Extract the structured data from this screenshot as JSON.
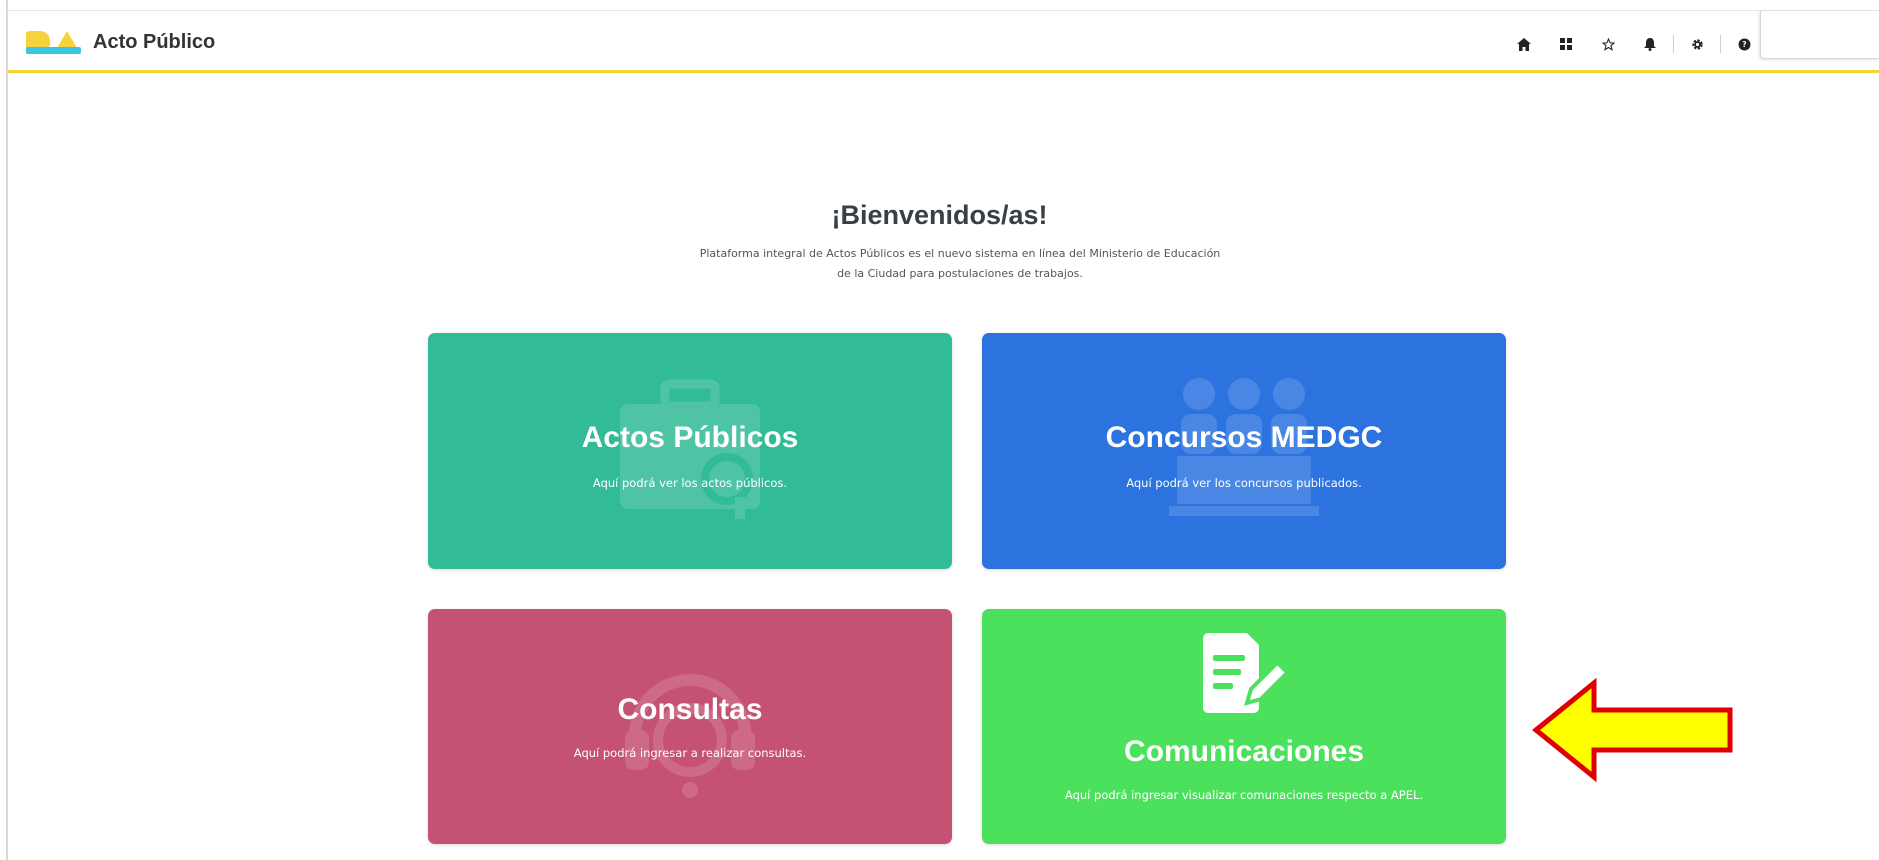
{
  "header": {
    "app_title": "Acto Público",
    "accent_color": "#f4d33a",
    "toolbar_icons": [
      "home-icon",
      "apps-grid-icon",
      "star-icon",
      "bell-icon",
      "gear-icon",
      "help-icon"
    ]
  },
  "welcome": {
    "title": "¡Bienvenidos/as!",
    "line1": "Plataforma integral de Actos Públicos es el nuevo sistema en línea del Ministerio de Educación",
    "line2": "de la Ciudad para postulaciones de trabajos."
  },
  "cards": [
    {
      "title": "Actos Públicos",
      "description": "Aquí podrá ver los actos públicos.",
      "color": "#31bb96",
      "icon": "briefcase-search-icon"
    },
    {
      "title": "Concursos MEDGC",
      "description": "Aquí podrá ver los concursos publicados.",
      "color": "#2c73e0",
      "icon": "panel-people-icon"
    },
    {
      "title": "Consultas",
      "description": "Aquí podrá ingresar a realizar consultas.",
      "color": "#c55173",
      "icon": "headset-help-icon"
    },
    {
      "title": "Comunicaciones",
      "description": "Aquí podrá ingresar visualizar comunaciones respecto a APEL.",
      "color": "#4ce15c",
      "icon": "document-edit-icon"
    }
  ],
  "annotation": {
    "icon": "yellow-arrow-left-icon",
    "fill": "#ffff00",
    "stroke": "#e10000"
  }
}
